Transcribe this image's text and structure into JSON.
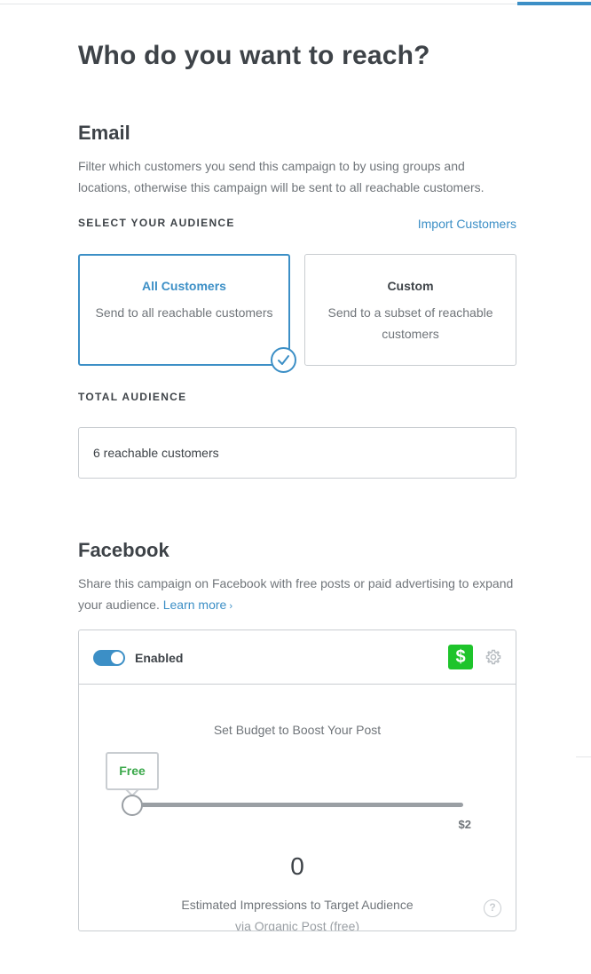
{
  "page": {
    "title": "Who do you want to reach?"
  },
  "email": {
    "heading": "Email",
    "description": "Filter which customers you send this campaign to by using groups and locations, otherwise this campaign will be sent to all reachable customers.",
    "select_label": "SELECT YOUR AUDIENCE",
    "import_link": "Import Customers",
    "options": [
      {
        "title": "All Customers",
        "description": "Send to all reachable customers",
        "selected": true
      },
      {
        "title": "Custom",
        "description": "Send to a subset of reachable customers",
        "selected": false
      }
    ],
    "total_label": "TOTAL AUDIENCE",
    "total_value": "6 reachable customers"
  },
  "facebook": {
    "heading": "Facebook",
    "description": "Share this campaign on Facebook with free posts or paid advertising to expand your audience.",
    "learn_more": "Learn more",
    "toggle_label": "Enabled",
    "toggle_on": true,
    "dollar_icon": "$",
    "budget_title": "Set Budget to Boost Your Post",
    "slider": {
      "current_label": "Free",
      "max_label": "$2",
      "level": 0
    },
    "impressions_value": "0",
    "impressions_label": "Estimated Impressions to Target Audience",
    "impressions_sub": "via Organic Post (free)",
    "help_icon": "?"
  },
  "colors": {
    "accent": "#3c8fc6",
    "green": "#1ec42b",
    "free_text": "#3aa84a",
    "text": "#3e4348",
    "muted": "#70757a",
    "border": "#c9cdd1"
  }
}
